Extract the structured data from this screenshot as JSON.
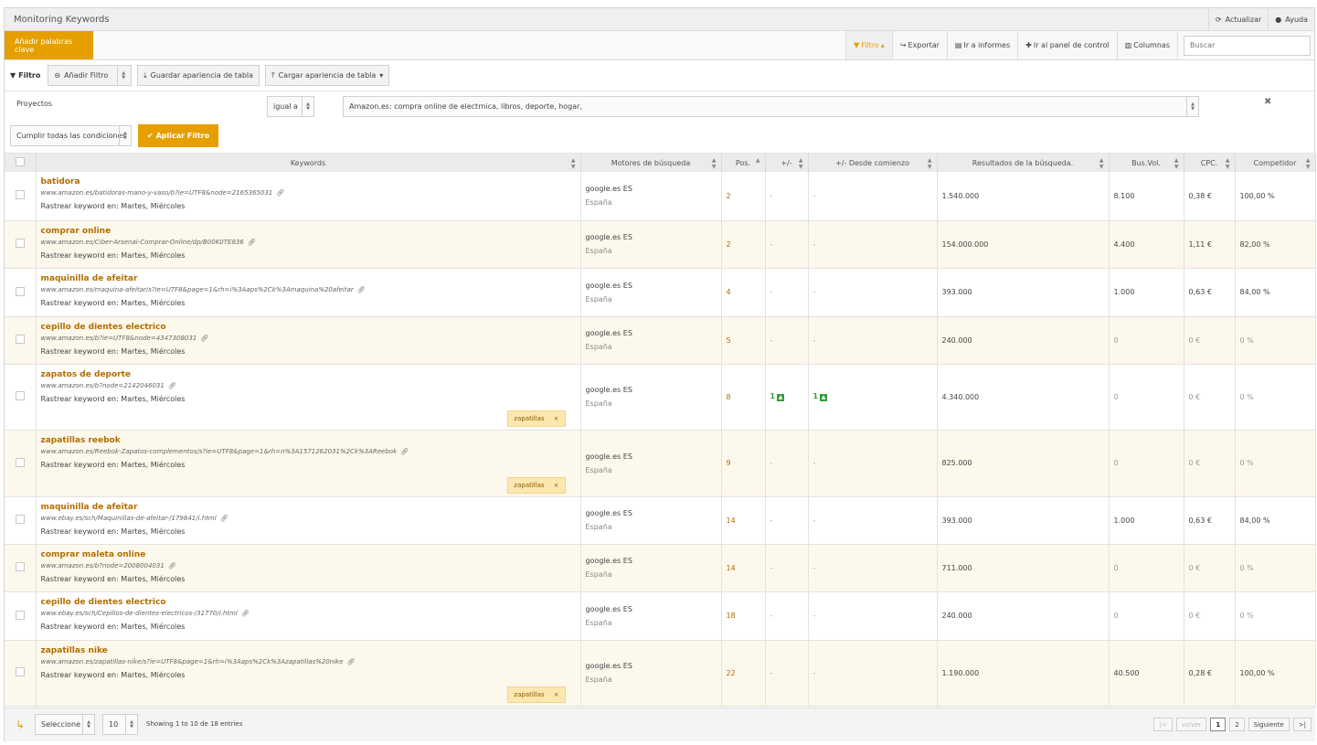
{
  "window": {
    "title": "Monitoring Keywords"
  },
  "header_actions": {
    "refresh": "Actualizar",
    "help": "Ayuda"
  },
  "toolbar": {
    "add_keywords": "Añadir palabras clave",
    "filter": "Filtro",
    "export": "Exportar",
    "reports": "Ir a informes",
    "dashboard": "Ir al panel de control",
    "columns": "Columnas",
    "search_placeholder": "Buscar"
  },
  "filterbar": {
    "label": "Filtro",
    "add_filter": "Añadir Filtro",
    "save_layout": "Guardar apariencia de tabla",
    "load_layout": "Cargar apariencia de tabla"
  },
  "filter_row": {
    "field": "Proyectos",
    "operator": "igual a",
    "value": "Amazon.es: compra online de electrnica, libros, deporte, hogar,"
  },
  "conditions": {
    "mode": "Cumplir todas las condiciones",
    "apply": "Aplicar Filtro"
  },
  "table": {
    "columns": {
      "keywords": "Keywords",
      "engines": "Motores de búsqueda",
      "pos": "Pos.",
      "change": "+/-",
      "since_start": "+/- Desde comienzo",
      "results": "Resultados de la búsqueda.",
      "volume": "Bus.Vol.",
      "cpc": "CPC.",
      "competitor": "Competidor"
    },
    "rows": [
      {
        "keyword": "batidora",
        "url": "www.amazon.es/batidoras-mano-y-vaso/b?ie=UTF8&node=2165365031",
        "track": "Rastrear keyword en: Martes, Miércoles",
        "tag": "",
        "engine": "google.es ES",
        "location": "España",
        "pos": "2",
        "change": "-",
        "since": "-",
        "results": "1.540.000",
        "volume": "8.100",
        "cpc": "0,38 €",
        "competitor": "100,00 %"
      },
      {
        "keyword": "comprar online",
        "url": "www.amazon.es/Ciber-Arsenal-Comprar-Online/dp/B00K0TE836",
        "track": "Rastrear keyword en: Martes, Miércoles",
        "tag": "",
        "engine": "google.es ES",
        "location": "España",
        "pos": "2",
        "change": "-",
        "since": "-",
        "results": "154.000.000",
        "volume": "4.400",
        "cpc": "1,11 €",
        "competitor": "82,00 %"
      },
      {
        "keyword": "maquinilla de afeitar",
        "url": "www.amazon.es/maquina-afeitar/s?ie=UTF8&page=1&rh=i%3Aaps%2Ck%3Amaquina%20afeitar",
        "track": "Rastrear keyword en: Martes, Miércoles",
        "tag": "",
        "engine": "google.es ES",
        "location": "España",
        "pos": "4",
        "change": "-",
        "since": "-",
        "results": "393.000",
        "volume": "1.000",
        "cpc": "0,63 €",
        "competitor": "84,00 %"
      },
      {
        "keyword": "cepillo de dientes electrico",
        "url": "www.amazon.es/b?ie=UTF8&node=4347308031",
        "track": "Rastrear keyword en: Martes, Miércoles",
        "tag": "",
        "engine": "google.es ES",
        "location": "España",
        "pos": "5",
        "change": "-",
        "since": "-",
        "results": "240.000",
        "volume": "0",
        "cpc": "0 €",
        "competitor": "0 %"
      },
      {
        "keyword": "zapatos de deporte",
        "url": "www.amazon.es/b?node=2142046031",
        "track": "Rastrear keyword en: Martes, Miércoles",
        "tag": "zapatillas",
        "engine": "google.es ES",
        "location": "España",
        "pos": "8",
        "change": "1",
        "since": "1",
        "results": "4.340.000",
        "volume": "0",
        "cpc": "0 €",
        "competitor": "0 %"
      },
      {
        "keyword": "zapatillas reebok",
        "url": "www.amazon.es/Reebok-Zapatos-complementos/s?ie=UTF8&page=1&rh=n%3A1571262031%2Ck%3AReebok",
        "track": "Rastrear keyword en: Martes, Miércoles",
        "tag": "zapatillas",
        "engine": "google.es ES",
        "location": "España",
        "pos": "9",
        "change": "-",
        "since": "-",
        "results": "825.000",
        "volume": "0",
        "cpc": "0 €",
        "competitor": "0 %"
      },
      {
        "keyword": "maquinilla de afeitar",
        "url": "www.ebay.es/sch/Maquinillas-de-afeitar-/179841/i.html",
        "track": "Rastrear keyword en: Martes, Miércoles",
        "tag": "",
        "engine": "google.es ES",
        "location": "España",
        "pos": "14",
        "change": "-",
        "since": "-",
        "results": "393.000",
        "volume": "1.000",
        "cpc": "0,63 €",
        "competitor": "84,00 %"
      },
      {
        "keyword": "comprar maleta online",
        "url": "www.amazon.es/b?node=2008004031",
        "track": "Rastrear keyword en: Martes, Miércoles",
        "tag": "",
        "engine": "google.es ES",
        "location": "España",
        "pos": "14",
        "change": "-",
        "since": "-",
        "results": "711.000",
        "volume": "0",
        "cpc": "0 €",
        "competitor": "0 %"
      },
      {
        "keyword": "cepillo de dientes electrico",
        "url": "www.ebay.es/sch/Cepillos-de-dientes-electricos-/31770/i.html",
        "track": "Rastrear keyword en: Martes, Miércoles",
        "tag": "",
        "engine": "google.es ES",
        "location": "España",
        "pos": "18",
        "change": "-",
        "since": "-",
        "results": "240.000",
        "volume": "0",
        "cpc": "0 €",
        "competitor": "0 %"
      },
      {
        "keyword": "zapatillas nike",
        "url": "www.amazon.es/zapatillas-nike/s?ie=UTF8&page=1&rh=i%3Aaps%2Ck%3Azapatillas%20nike",
        "track": "Rastrear keyword en: Martes, Miércoles",
        "tag": "zapatillas",
        "engine": "google.es ES",
        "location": "España",
        "pos": "22",
        "change": "-",
        "since": "-",
        "results": "1.190.000",
        "volume": "40.500",
        "cpc": "0,28 €",
        "competitor": "100,00 %"
      }
    ]
  },
  "footer": {
    "bulk_select": "Seleccione",
    "page_size": "10",
    "showing": "Showing 1 to 10 de 18 entries",
    "first": "|<",
    "prev": "volver",
    "pages": [
      "1",
      "2"
    ],
    "next": "Siguiente",
    "last": ">|"
  }
}
